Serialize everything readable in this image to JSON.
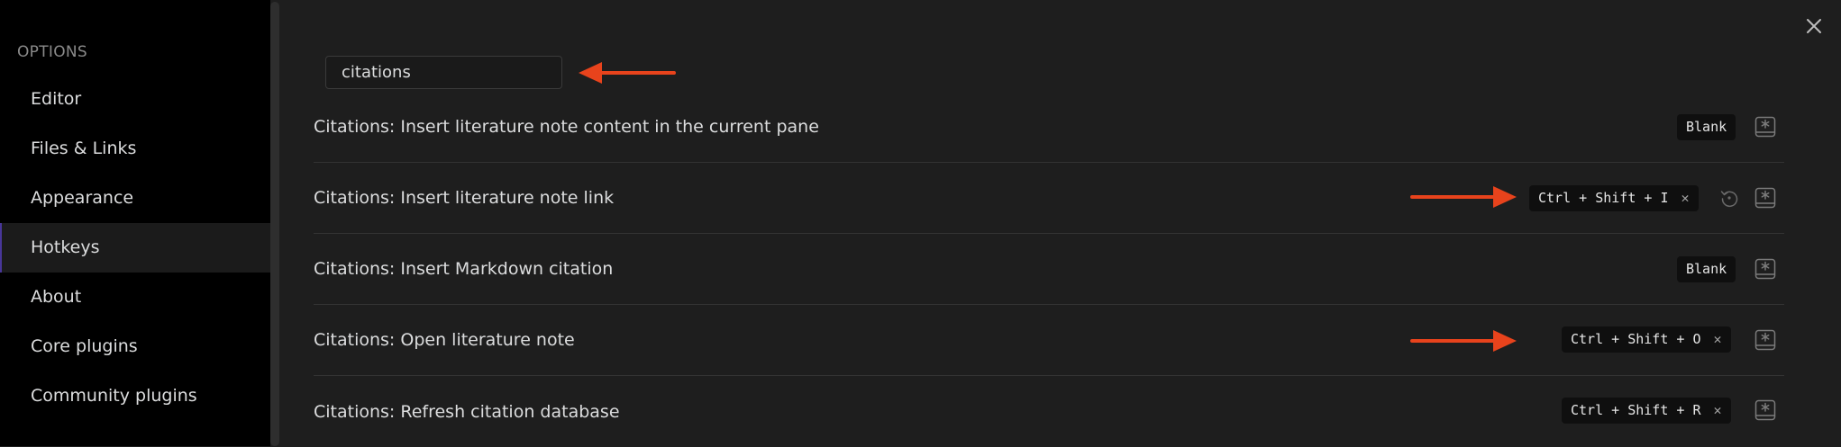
{
  "sidebar": {
    "heading": "OPTIONS",
    "items": [
      {
        "label": "Editor",
        "active": false
      },
      {
        "label": "Files & Links",
        "active": false
      },
      {
        "label": "Appearance",
        "active": false
      },
      {
        "label": "Hotkeys",
        "active": true
      },
      {
        "label": "About",
        "active": false
      },
      {
        "label": "Core plugins",
        "active": false
      },
      {
        "label": "Community plugins",
        "active": false
      }
    ]
  },
  "search": {
    "value": "citations"
  },
  "hotkeys": [
    {
      "command": "Citations: Insert literature note content in the current pane",
      "hotkey": "Blank",
      "removable": false,
      "restore": false
    },
    {
      "command": "Citations: Insert literature note link",
      "hotkey": "Ctrl + Shift + I",
      "removable": true,
      "restore": true
    },
    {
      "command": "Citations: Insert Markdown citation",
      "hotkey": "Blank",
      "removable": false,
      "restore": false
    },
    {
      "command": "Citations: Open literature note",
      "hotkey": "Ctrl + Shift + O",
      "removable": true,
      "restore": false
    },
    {
      "command": "Citations: Refresh citation database",
      "hotkey": "Ctrl + Shift + R",
      "removable": true,
      "restore": false
    }
  ],
  "icons": {
    "close": "close-icon",
    "add_hotkey": "add-hotkey-icon",
    "restore_default": "restore-default-icon",
    "remove_hotkey": "remove-hotkey-icon",
    "annotation_arrow": "annotation-arrow-icon"
  },
  "colors": {
    "accent": "#483699",
    "annotation_arrow": "#e8431c",
    "background": "#1e1e1e",
    "sidebar": "#000000"
  }
}
